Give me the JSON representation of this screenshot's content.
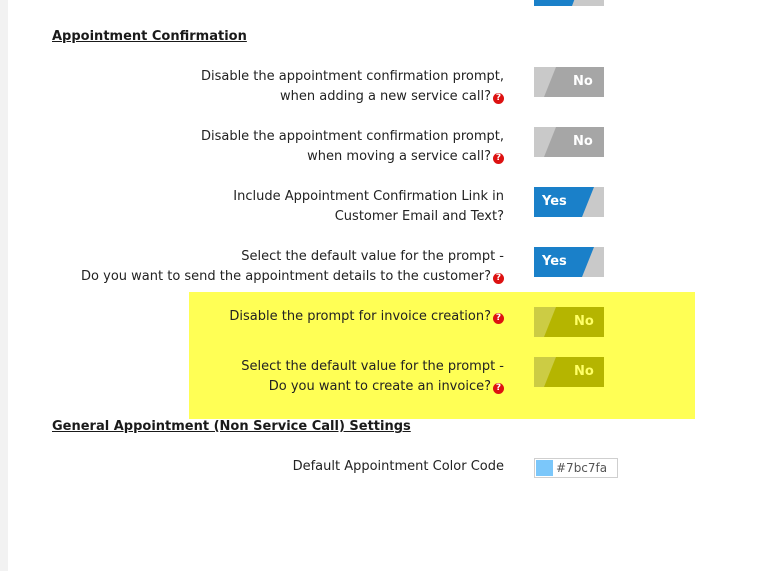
{
  "colors": {
    "highlight": "#ffff55",
    "toggle_off_dark": "#a6a6a6",
    "toggle_off_light": "#c9c9c9",
    "toggle_on": "#1a80c9",
    "toggle_hl_dark": "#b5b500",
    "toggle_hl_light": "#cccc44",
    "help_icon": "#dd1111",
    "appointment_color": "#7bc7fa"
  },
  "sections": {
    "appointment_confirmation": "Appointment Confirmation",
    "general_appointment": "General Appointment (Non Service Call) Settings"
  },
  "rows": [
    {
      "lines": [
        "Disable the appointment confirmation prompt,",
        "when adding a new service call?"
      ],
      "help_icon": "question-circle-icon",
      "toggle": "No"
    },
    {
      "lines": [
        "Disable the appointment confirmation prompt,",
        "when moving a service call?"
      ],
      "help_icon": "question-circle-icon",
      "toggle": "No"
    },
    {
      "lines": [
        "Include Appointment Confirmation Link in",
        "Customer Email and Text?"
      ],
      "toggle": "Yes"
    },
    {
      "lines": [
        "Select the default value for the prompt -",
        "Do you want to send the appointment details to the customer?"
      ],
      "help_icon": "question-circle-icon",
      "toggle": "Yes"
    },
    {
      "lines": [
        "Disable the prompt for invoice creation?"
      ],
      "help_icon": "question-circle-icon",
      "toggle": "No"
    },
    {
      "lines": [
        "Select the default value for the prompt -",
        "Do you want to create an invoice?"
      ],
      "help_icon": "question-circle-icon",
      "toggle": "No"
    }
  ],
  "default_color": {
    "label": "Default Appointment Color Code",
    "value": "#7bc7fa"
  },
  "help_glyph": "?"
}
